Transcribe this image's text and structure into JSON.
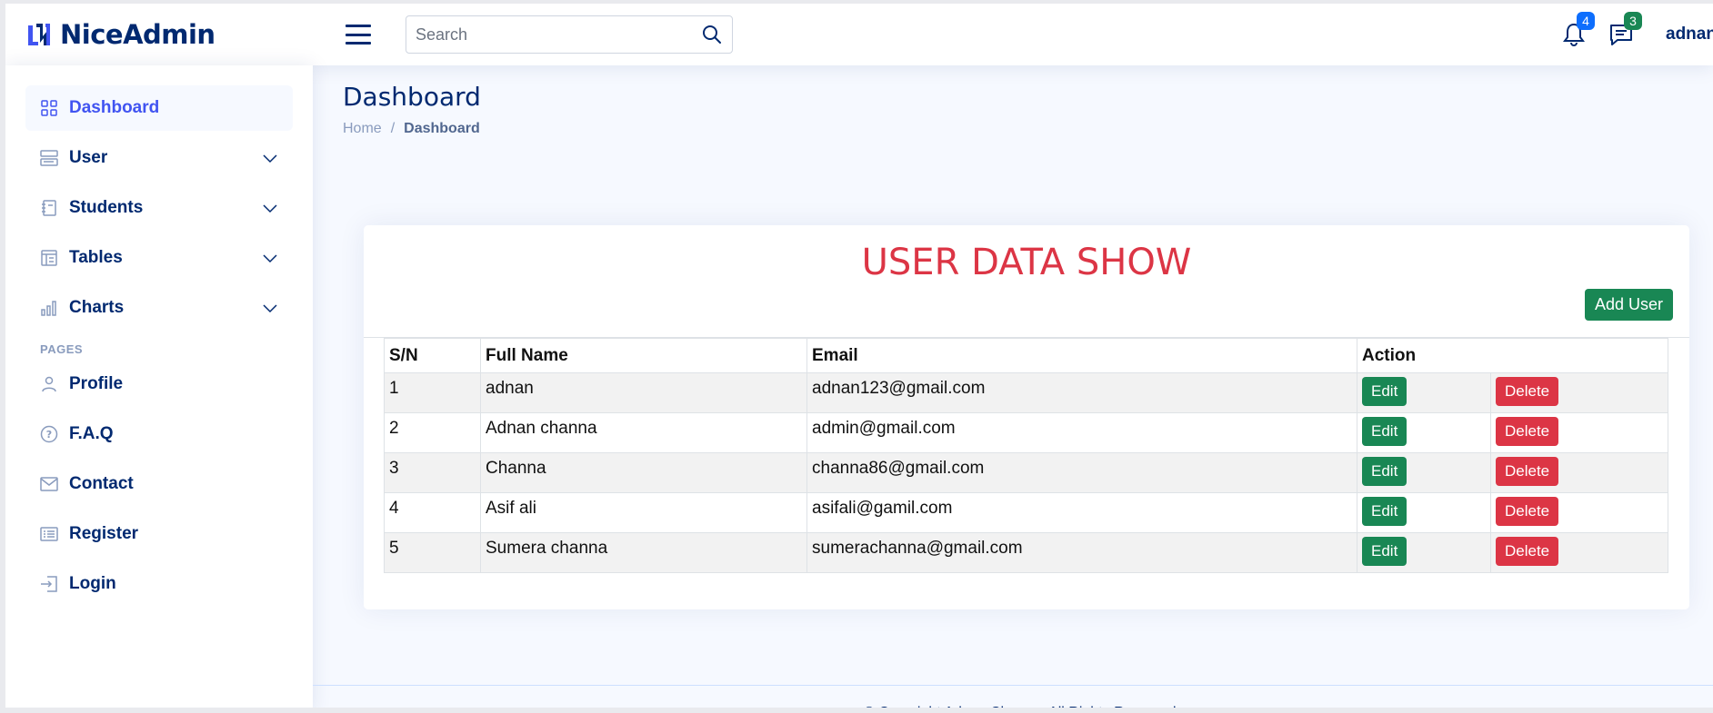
{
  "header": {
    "brand": "NiceAdmin",
    "search_placeholder": "Search",
    "notifications_count": "4",
    "messages_count": "3",
    "user_name": "adnan"
  },
  "sidebar": {
    "items": [
      {
        "label": "Dashboard",
        "icon": "grid-icon"
      },
      {
        "label": "User",
        "icon": "menu-button-icon"
      },
      {
        "label": "Students",
        "icon": "journal-icon"
      },
      {
        "label": "Tables",
        "icon": "layout-text-icon"
      },
      {
        "label": "Charts",
        "icon": "bar-chart-icon"
      }
    ],
    "pages_heading": "PAGES",
    "pages": [
      {
        "label": "Profile",
        "icon": "person-icon"
      },
      {
        "label": "F.A.Q",
        "icon": "question-circle-icon"
      },
      {
        "label": "Contact",
        "icon": "envelope-icon"
      },
      {
        "label": "Register",
        "icon": "card-list-icon"
      },
      {
        "label": "Login",
        "icon": "box-arrow-in-right-icon"
      }
    ]
  },
  "page": {
    "title": "Dashboard",
    "breadcrumb_home": "Home",
    "breadcrumb_sep": "/",
    "breadcrumb_current": "Dashboard"
  },
  "card": {
    "title": "USER DATA SHOW",
    "add_button": "Add User",
    "columns": [
      "S/N",
      "Full Name",
      "Email",
      "Action"
    ],
    "rows": [
      {
        "sn": "1",
        "name": "adnan",
        "email": "adnan123@gmail.com"
      },
      {
        "sn": "2",
        "name": "Adnan channa",
        "email": "admin@gmail.com"
      },
      {
        "sn": "3",
        "name": "Channa",
        "email": "channa86@gmail.com"
      },
      {
        "sn": "4",
        "name": "Asif ali",
        "email": "asifali@gamil.com"
      },
      {
        "sn": "5",
        "name": "Sumera channa",
        "email": "sumerachanna@gmail.com"
      }
    ],
    "edit_label": "Edit",
    "delete_label": "Delete"
  },
  "footer": {
    "text": "© Copyright Adnan Channa. All Rights Reserved"
  },
  "colors": {
    "brand": "#012970",
    "accent": "#4154f1",
    "success": "#198754",
    "danger": "#dc3545"
  }
}
